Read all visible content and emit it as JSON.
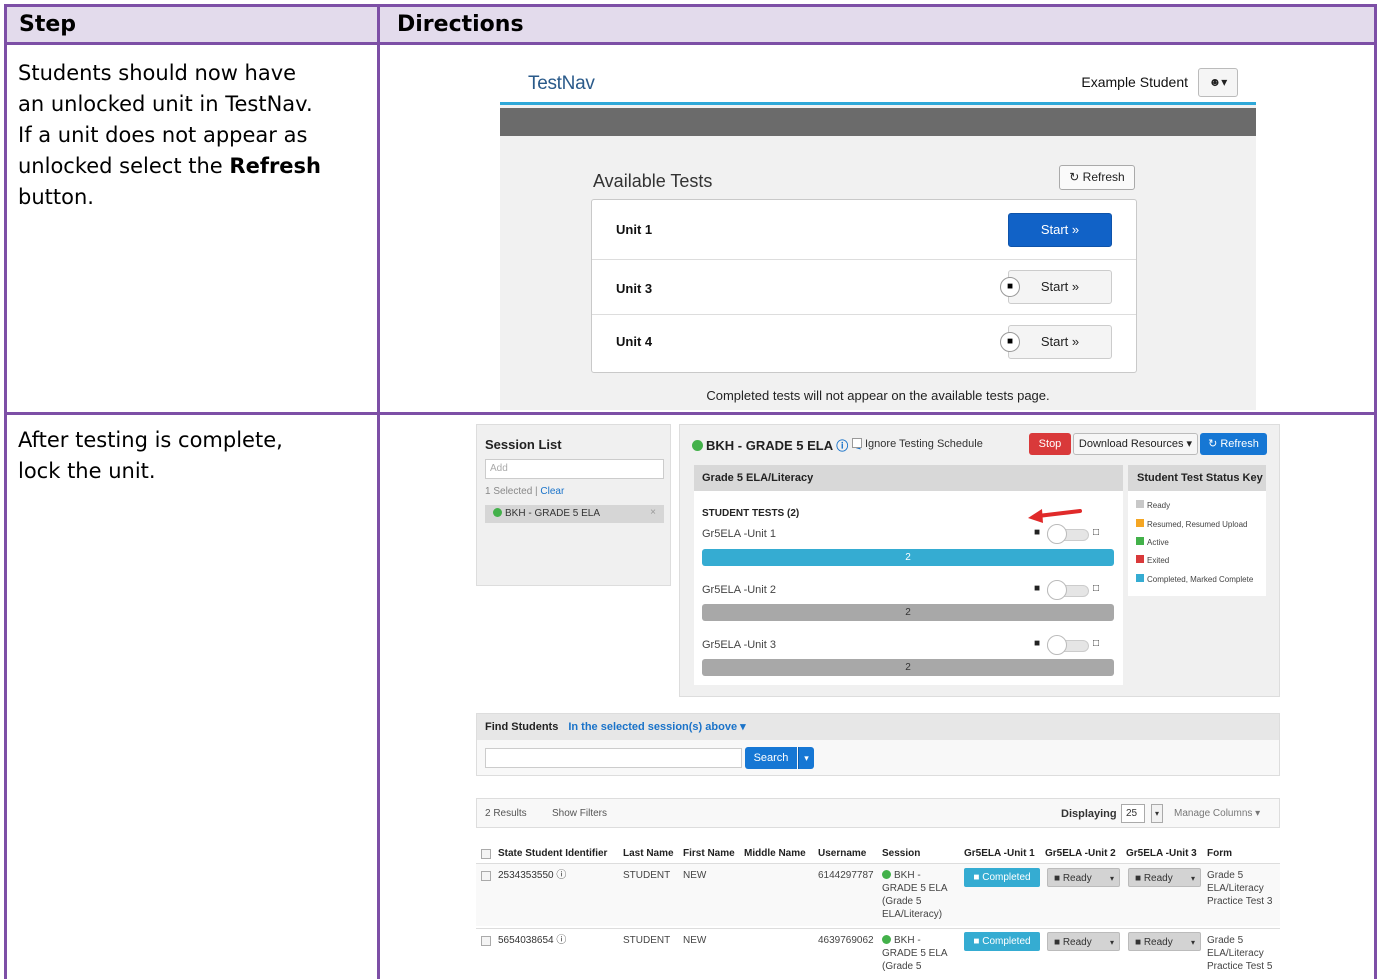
{
  "table": {
    "header_step": "Step",
    "header_directions": "Directions",
    "row1": {
      "line1": "Students should now have",
      "line2": "an unlocked unit in TestNav.",
      "line3": "If a unit does not appear as",
      "line4_pre": "unlocked select the ",
      "line4_bold": "Refresh",
      "line5": "button."
    },
    "row2": {
      "line1": "After testing is complete,",
      "line2": "lock the unit."
    }
  },
  "testnav": {
    "logo": "TestNav",
    "user_name": "Example Student",
    "user_menu_glyph": "☻▾",
    "title": "Available Tests",
    "refresh_label": "↻ Refresh",
    "units": [
      {
        "name": "Unit 1",
        "start": "Start »",
        "locked": false
      },
      {
        "name": "Unit 3",
        "start": "Start »",
        "locked": true
      },
      {
        "name": "Unit 4",
        "start": "Start »",
        "locked": true
      }
    ],
    "lock_glyph": "■",
    "footer": "Completed tests will not appear on the available tests page."
  },
  "pearson": {
    "session_list": {
      "title": "Session List",
      "add_placeholder": "Add",
      "selected_count": "1 Selected |",
      "clear": "Clear",
      "chip": "BKH - GRADE 5 ELA",
      "chip_close": "×"
    },
    "session": {
      "title": "BKH - GRADE 5 ELA",
      "info_glyphs": "ⓘ ✎",
      "ignore_label": "Ignore Testing Schedule",
      "stop": "Stop",
      "download": "Download Resources ▾",
      "refresh": "↻ Refresh",
      "grade_label": "Grade 5 ELA/Literacy",
      "student_tests": "STUDENT TESTS (2)",
      "units": [
        {
          "name": "Gr5ELA -Unit 1",
          "count": "2",
          "status": "completed"
        },
        {
          "name": "Gr5ELA -Unit 2",
          "count": "2",
          "status": "ready"
        },
        {
          "name": "Gr5ELA -Unit 3",
          "count": "2",
          "status": "ready"
        }
      ],
      "lock_glyph": "■",
      "unlock_glyph": "□"
    },
    "status_key": {
      "title": "Student Test Status Key",
      "items": [
        {
          "label": "Ready",
          "color": "#c8c8c8"
        },
        {
          "label": "Resumed, Resumed Upload",
          "color": "#f5a623"
        },
        {
          "label": "Active",
          "color": "#43b14a"
        },
        {
          "label": "Exited",
          "color": "#d9393a"
        },
        {
          "label": "Completed, Marked Complete",
          "color": "#35acd2"
        }
      ]
    },
    "find": {
      "title": "Find Students",
      "scope": "In the selected session(s) above ▾",
      "search": "Search",
      "search_dd": "▾"
    },
    "results": {
      "count": "2 Results",
      "filters": "Show Filters",
      "displaying": "Displaying",
      "page_size": "25",
      "page_size_dd": "▾",
      "manage": "Manage Columns ▾"
    },
    "grid": {
      "columns": [
        "State Student Identifier",
        "Last Name",
        "First Name",
        "Middle Name",
        "Username",
        "Session",
        "Gr5ELA -Unit 1",
        "Gr5ELA -Unit 2",
        "Gr5ELA -Unit 3",
        "Form"
      ],
      "rows": [
        {
          "id": "2534353550 ⓘ",
          "last": "STUDENT",
          "first": "NEW",
          "username": "6144297787",
          "session": [
            "BKH -",
            "GRADE 5 ELA",
            "(Grade 5",
            "ELA/Literacy)"
          ],
          "u1": "■ Completed",
          "u2": "■ Ready",
          "u3": "■ Ready",
          "form": [
            "Grade 5",
            "ELA/Literacy",
            "Practice Test 3"
          ]
        },
        {
          "id": "5654038654 ⓘ",
          "last": "STUDENT",
          "first": "NEW",
          "username": "4639769062",
          "session": [
            "BKH -",
            "GRADE 5 ELA",
            "(Grade 5"
          ],
          "u1": "■ Completed",
          "u2": "■ Ready",
          "u3": "■ Ready",
          "form": [
            "Grade 5",
            "ELA/Literacy",
            "Practice Test 5"
          ]
        }
      ],
      "caret": "▾"
    }
  }
}
